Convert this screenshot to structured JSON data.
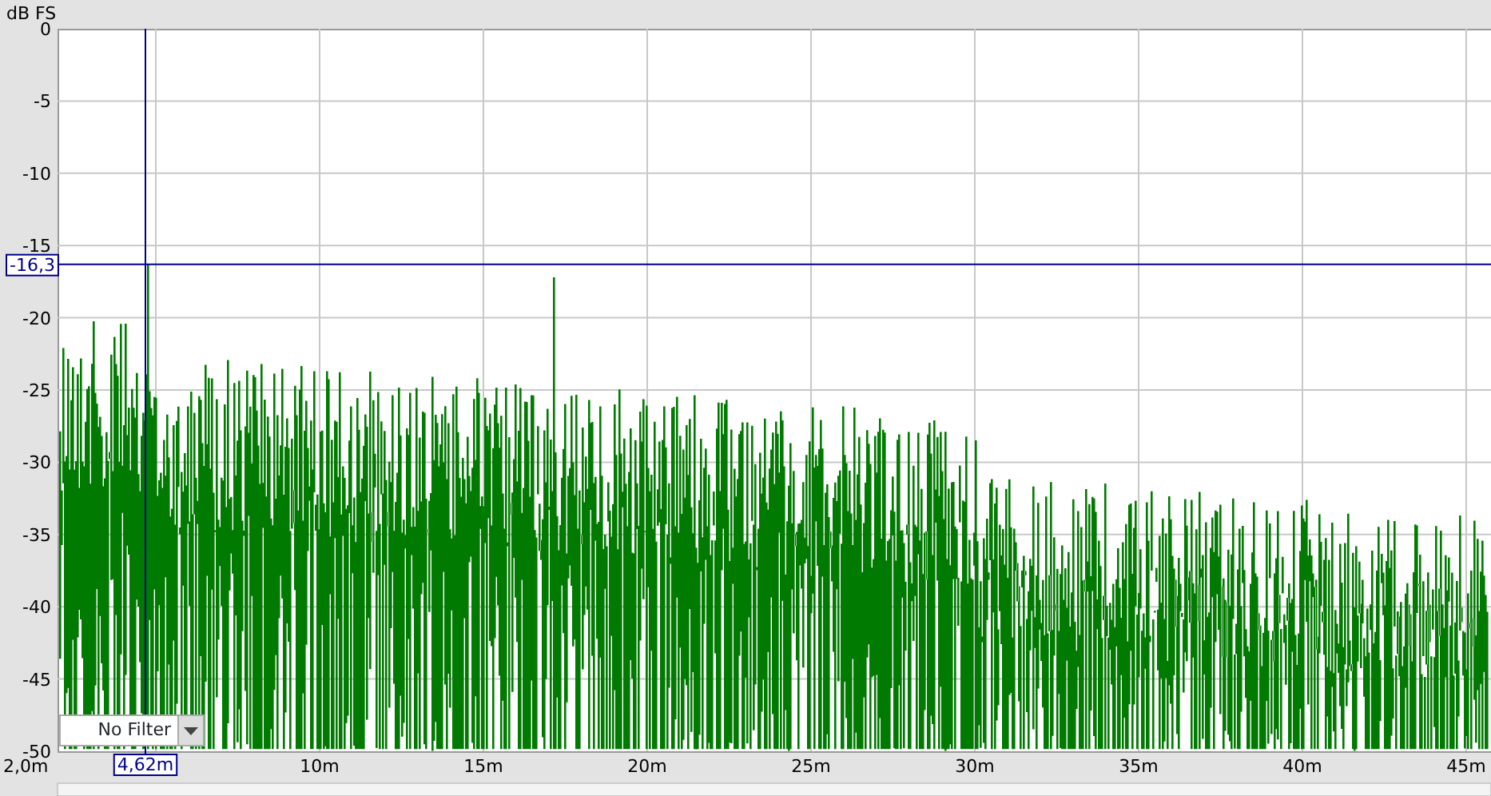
{
  "y_axis": {
    "unit": "dB FS",
    "ticks": [
      "0",
      "-5",
      "-10",
      "-15",
      "-20",
      "-25",
      "-30",
      "-35",
      "-40",
      "-45",
      "-50"
    ]
  },
  "x_axis": {
    "ticks": [
      "2,0m",
      "10m",
      "15m",
      "20m",
      "25m",
      "30m",
      "35m",
      "40m",
      "45m"
    ]
  },
  "cursor": {
    "y_reading": "-16,3",
    "x_reading": "4,62m"
  },
  "filter": {
    "value": "No Filter"
  }
}
